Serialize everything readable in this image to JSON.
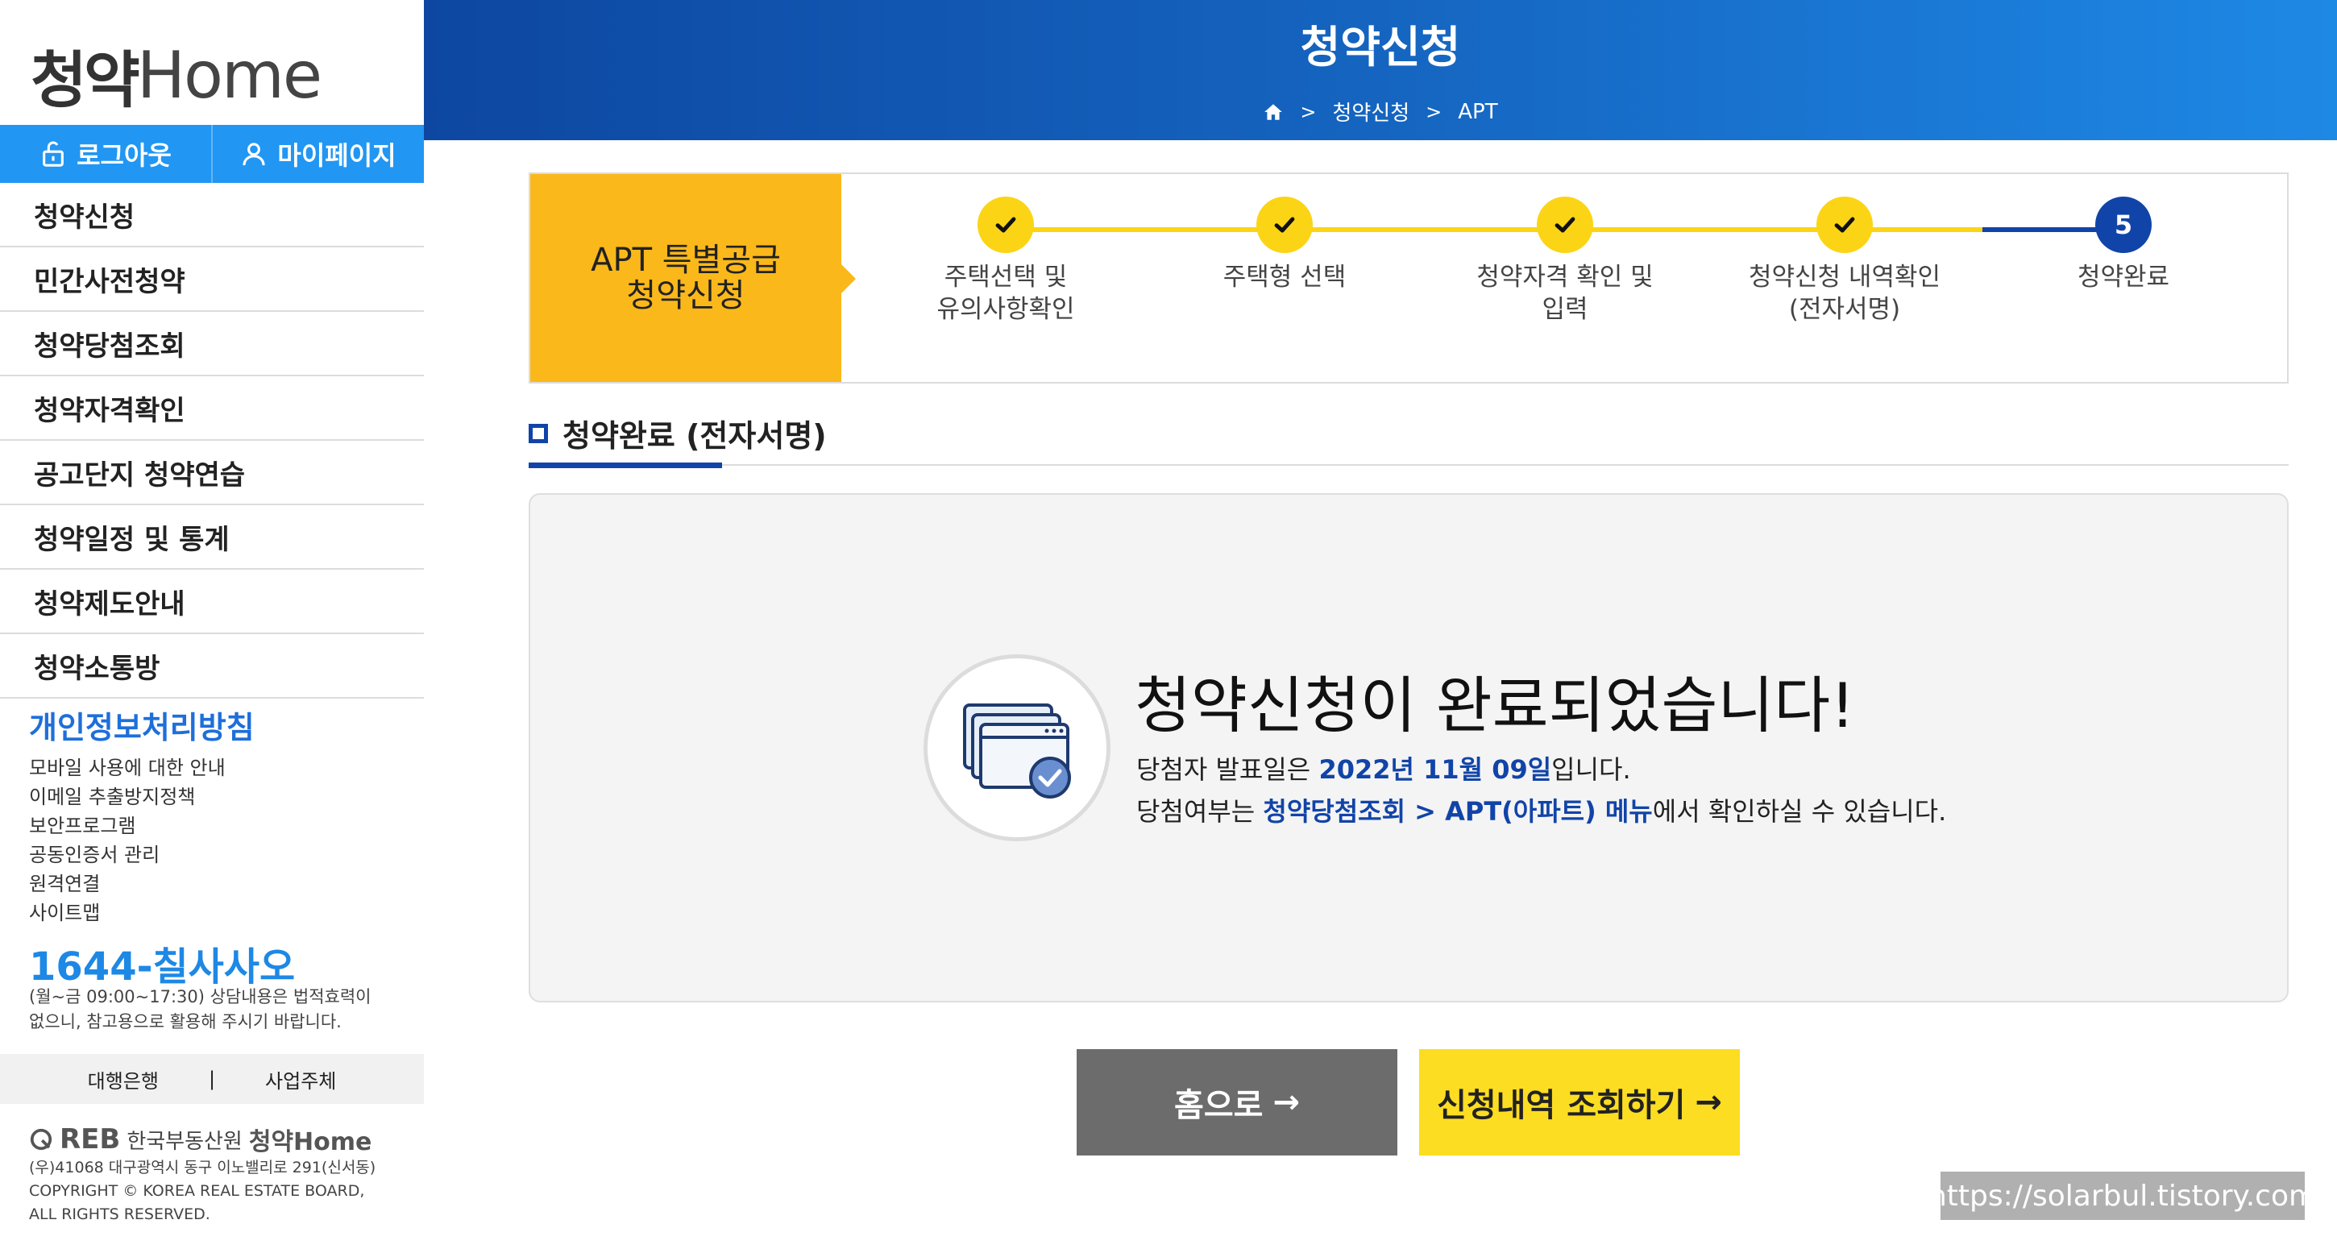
{
  "sidebar": {
    "logo_ko": "청약",
    "logo_en": "Home",
    "logout_label": "로그아웃",
    "mypage_label": "마이페이지",
    "menu": [
      {
        "label": "청약신청"
      },
      {
        "label": "민간사전청약"
      },
      {
        "label": "청약당첨조회"
      },
      {
        "label": "청약자격확인"
      },
      {
        "label": "공고단지 청약연습"
      },
      {
        "label": "청약일정 및 통계"
      },
      {
        "label": "청약제도안내"
      },
      {
        "label": "청약소통방"
      }
    ],
    "privacy": "개인정보처리방침",
    "sub_links": [
      "모바일 사용에 대한 안내",
      "이메일 추출방지정책",
      "보안프로그램",
      "공동인증서 관리",
      "원격연결",
      "사이트맵"
    ],
    "phone": "1644-칠사사오",
    "phone_note_1": "(월~금 09:00~17:30) 상담내용은 법적효력이",
    "phone_note_2": "없으니, 참고용으로 활용해 주시기 바랍니다.",
    "partner_1": "대행은행",
    "partner_sep": "|",
    "partner_2": "사업주체",
    "footer_reb": "REB",
    "footer_org": "한국부동산원",
    "footer_brand": "청약Home",
    "footer_address": "(우)41068 대구광역시 동구 이노밸리로 291(신서동)",
    "footer_copyright_1": "COPYRIGHT © KOREA REAL ESTATE BOARD,",
    "footer_copyright_2": "ALL RIGHTS RESERVED."
  },
  "header": {
    "title": "청약신청",
    "breadcrumb": [
      "청약신청",
      "APT"
    ],
    "breadcrumb_sep": ">"
  },
  "steps": {
    "label_1": "APT 특별공급",
    "label_2": "청약신청",
    "items": [
      {
        "line1": "주택선택 및",
        "line2": "유의사항확인",
        "status": "done"
      },
      {
        "line1": "주택형 선택",
        "line2": "",
        "status": "done"
      },
      {
        "line1": "청약자격 확인 및",
        "line2": "입력",
        "status": "done"
      },
      {
        "line1": "청약신청 내역확인",
        "line2": "(전자서명)",
        "status": "done"
      },
      {
        "line1": "청약완료",
        "line2": "",
        "status": "active",
        "number": "5"
      }
    ]
  },
  "section": {
    "title": "청약완료 (전자서명)"
  },
  "content": {
    "title": "청약신청이 완료되었습니다!",
    "line1_prefix": "당첨자 발표일은 ",
    "line1_highlight": "2022년 11월 09일",
    "line1_suffix": "입니다.",
    "line2_prefix": "당첨여부는 ",
    "line2_highlight": "청약당첨조회 > APT(아파트) 메뉴",
    "line2_suffix": "에서 확인하실 수 있습니다."
  },
  "buttons": {
    "home": "홈으로",
    "lookup": "신청내역 조회하기",
    "arrow": "→"
  },
  "watermark": "https://solarbul.tistory.com",
  "colors": {
    "header_blue": "#1565c0",
    "accent_blue": "#1144a8",
    "step_yellow": "#fbd415",
    "label_yellow": "#fbb81a",
    "button_gray": "#6c6c6c",
    "button_yellow": "#fcdd21"
  }
}
